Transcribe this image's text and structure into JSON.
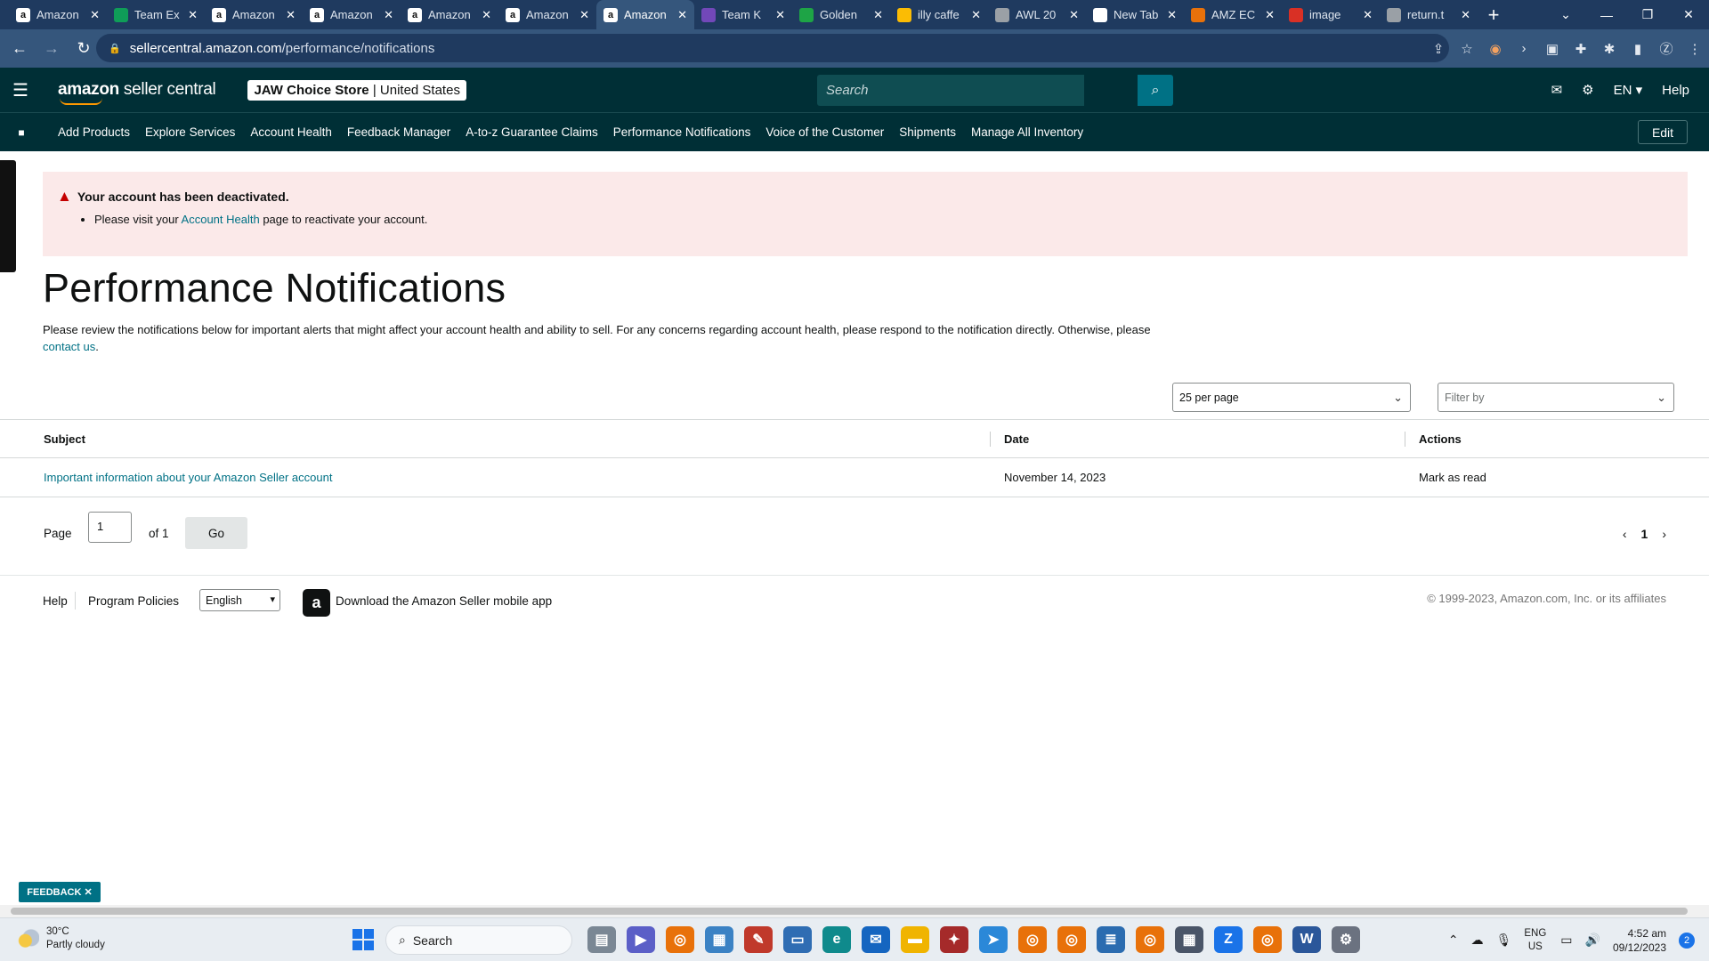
{
  "browser": {
    "tabs": [
      {
        "label": "Amazon",
        "icon": "amazon-icon",
        "color": "#ffffff"
      },
      {
        "label": "Team Ex",
        "icon": "sheets-icon",
        "color": "#0f9d58"
      },
      {
        "label": "Amazon",
        "icon": "amazon-icon",
        "color": "#ffffff"
      },
      {
        "label": "Amazon",
        "icon": "amazon-icon",
        "color": "#ffffff"
      },
      {
        "label": "Amazon",
        "icon": "amazon-icon",
        "color": "#ffffff"
      },
      {
        "label": "Amazon",
        "icon": "amazon-icon",
        "color": "#ffffff"
      },
      {
        "label": "Amazon",
        "icon": "amazon-icon",
        "color": "#ffffff",
        "active": true
      },
      {
        "label": "Team K",
        "icon": "forms-icon",
        "color": "#7248b9"
      },
      {
        "label": "Golden",
        "icon": "golden-icon",
        "color": "#1ea446"
      },
      {
        "label": "illy caffe",
        "icon": "drive-icon",
        "color": "#fbbc04"
      },
      {
        "label": "AWL 20",
        "icon": "globe-icon",
        "color": "#9aa0a6"
      },
      {
        "label": "New Tab",
        "icon": "chrome-icon",
        "color": "#ffffff"
      },
      {
        "label": "AMZ EC",
        "icon": "amz-ec-icon",
        "color": "#e8710a"
      },
      {
        "label": "image",
        "icon": "image-icon",
        "color": "#d93025"
      },
      {
        "label": "return.t",
        "icon": "globe-icon",
        "color": "#9aa0a6"
      }
    ],
    "url_host": "sellercentral.amazon.com",
    "url_path": "/performance/notifications"
  },
  "header": {
    "logo_strong": "amazon",
    "logo_rest": " seller central",
    "store_name": "JAW Choice Store",
    "store_region": " | United States",
    "search_placeholder": "Search",
    "language": "EN",
    "help": "Help"
  },
  "nav": {
    "items": [
      "Add Products",
      "Explore Services",
      "Account Health",
      "Feedback Manager",
      "A-to-z Guarantee Claims",
      "Performance Notifications",
      "Voice of the Customer",
      "Shipments",
      "Manage All Inventory"
    ],
    "edit": "Edit"
  },
  "alert": {
    "title": "Your account has been deactivated.",
    "pre": "Please visit your ",
    "link": "Account Health",
    "post": " page to reactivate your account."
  },
  "page": {
    "title": "Performance Notifications",
    "intro": "Please review the notifications below for important alerts that might affect your account health and ability to sell. For any concerns regarding account health, please respond to the notification directly. Otherwise, please ",
    "contact_link": "contact us",
    "contact_end": "."
  },
  "controls": {
    "per_page": "25 per page",
    "filter_placeholder": "Filter by"
  },
  "table": {
    "headers": [
      "Subject",
      "Date",
      "Actions"
    ],
    "rows": [
      {
        "subject": "Important information about your Amazon Seller account",
        "date": "November 14, 2023",
        "action": "Mark as read"
      }
    ]
  },
  "pagination": {
    "page_label": "Page",
    "page_value": "1",
    "of_label": "of 1",
    "go": "Go",
    "current": "1"
  },
  "footer": {
    "help": "Help",
    "policies": "Program Policies",
    "language": "English",
    "app": "Download the Amazon Seller mobile app",
    "copyright": "© 1999-2023, Amazon.com, Inc. or its affiliates"
  },
  "feedback": "FEEDBACK",
  "taskbar": {
    "temp": "30°C",
    "weather": "Partly cloudy",
    "search": "Search",
    "lang_top": "ENG",
    "lang_bottom": "US",
    "time": "4:52 am",
    "date": "09/12/2023",
    "notifications": "2"
  }
}
